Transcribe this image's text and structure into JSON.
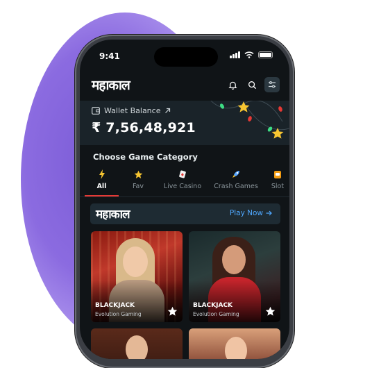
{
  "status_bar": {
    "time": "9:41"
  },
  "header": {
    "logo": "महाकाल"
  },
  "wallet": {
    "label": "Wallet Balance",
    "amount": "₹ 7,56,48,921"
  },
  "categories": {
    "title": "Choose Game Category",
    "tabs": [
      {
        "label": "All",
        "icon": "lightning-icon",
        "active": true
      },
      {
        "label": "Fav",
        "icon": "star-icon",
        "active": false
      },
      {
        "label": "Live Casino",
        "icon": "cards-icon",
        "active": false
      },
      {
        "label": "Crash Games",
        "icon": "rocket-icon",
        "active": false
      },
      {
        "label": "Slot",
        "icon": "slot-icon",
        "active": false
      }
    ]
  },
  "promo": {
    "logo": "महाकाल",
    "cta": "Play Now"
  },
  "games": [
    {
      "name": "BLACKJACK",
      "provider": "Evolution Gaming"
    },
    {
      "name": "BLACKJACK",
      "provider": "Evolution Gaming"
    }
  ],
  "colors": {
    "accent": "#e53935",
    "link": "#4fa8ff",
    "background": "#101417",
    "blob": "#8b6be0"
  }
}
